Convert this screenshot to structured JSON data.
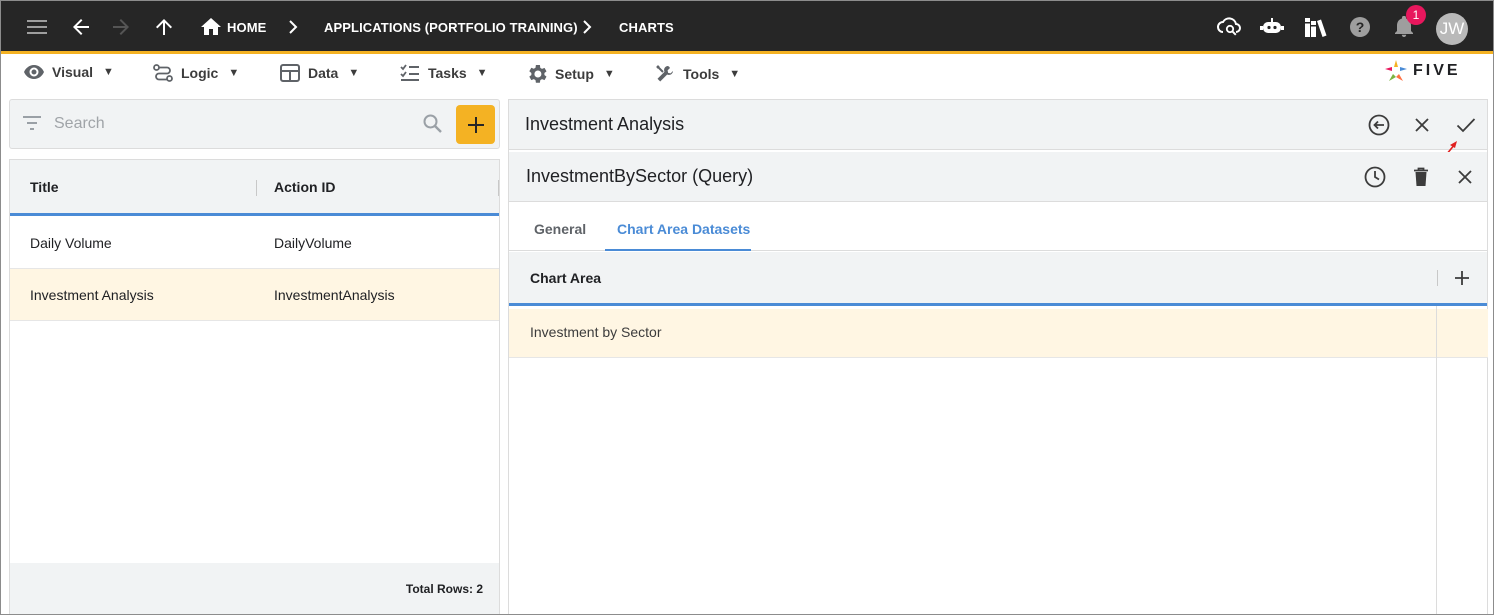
{
  "topbar": {
    "breadcrumbs": [
      "HOME",
      "APPLICATIONS (PORTFOLIO TRAINING)",
      "CHARTS"
    ],
    "notification_count": "1",
    "avatar_initials": "JW",
    "accent_color": "#f4b223"
  },
  "menubar": {
    "items": [
      "Visual",
      "Logic",
      "Data",
      "Tasks",
      "Setup",
      "Tools"
    ],
    "logo_text": "FIVE"
  },
  "left": {
    "search_placeholder": "Search",
    "columns": [
      "Title",
      "Action ID"
    ],
    "rows": [
      {
        "title": "Daily Volume",
        "action_id": "DailyVolume",
        "selected": false
      },
      {
        "title": "Investment Analysis",
        "action_id": "InvestmentAnalysis",
        "selected": true
      }
    ],
    "total_rows": "Total Rows: 2"
  },
  "right": {
    "title": "Investment Analysis",
    "subtitle": "InvestmentBySector (Query)",
    "tabs": [
      "General",
      "Chart Area Datasets"
    ],
    "active_tab": "Chart Area Datasets",
    "table_header": "Chart Area",
    "rows": [
      "Investment by Sector"
    ]
  },
  "icons": [
    "menu-icon",
    "back-arrow-icon",
    "forward-arrow-icon",
    "up-arrow-icon",
    "home-icon",
    "cloud-search-icon",
    "chatbot-icon",
    "books-icon",
    "help-icon",
    "bell-icon",
    "eye-icon",
    "logic-icon",
    "table-icon",
    "checklist-icon",
    "gear-icon",
    "tools-icon",
    "filter-icon",
    "search-icon",
    "plus-icon",
    "history-back-icon",
    "close-icon",
    "check-icon",
    "clock-icon",
    "trash-icon"
  ]
}
